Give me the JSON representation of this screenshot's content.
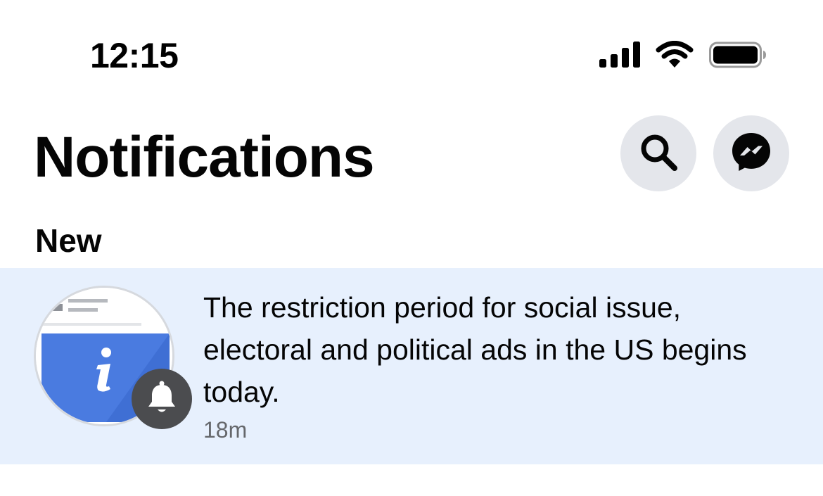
{
  "status_bar": {
    "time": "12:15",
    "icons": [
      "cellular-signal-icon",
      "wifi-icon",
      "battery-icon"
    ]
  },
  "header": {
    "title": "Notifications",
    "actions": [
      "search-icon",
      "messenger-icon"
    ]
  },
  "section": {
    "label": "New"
  },
  "notifications": [
    {
      "text": "The restriction period for social issue, electoral and political ads in the US begins today.",
      "time": "18m",
      "unread": true,
      "avatar_icon": "info-icon",
      "badge_icon": "bell-icon"
    }
  ],
  "colors": {
    "unread_background": "#e7f0fd",
    "header_button_background": "#e4e6eb",
    "secondary_text": "#65676b",
    "info_blue": "#4a7be0"
  }
}
